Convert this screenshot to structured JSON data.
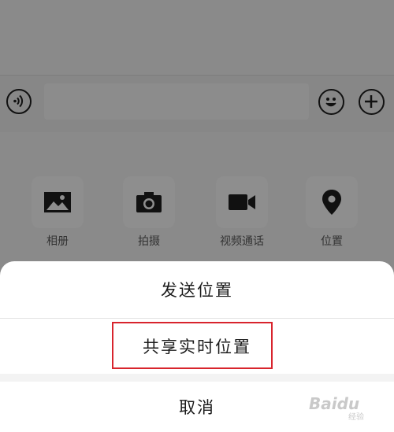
{
  "input_bar": {
    "voice_icon": "voice-wave-icon",
    "emoji_icon": "smiley-icon",
    "plus_icon": "plus-circle-icon"
  },
  "tools": [
    {
      "label": "相册",
      "icon": "photo-icon"
    },
    {
      "label": "拍摄",
      "icon": "camera-icon"
    },
    {
      "label": "视频通话",
      "icon": "video-call-icon"
    },
    {
      "label": "位置",
      "icon": "location-pin-icon"
    }
  ],
  "sheet": {
    "send_location": "发送位置",
    "share_live_location": "共享实时位置",
    "cancel": "取消"
  },
  "colors": {
    "overlay": "#898989",
    "sheet_bg": "#ffffff",
    "highlight": "#d8242d"
  },
  "watermark": {
    "text": "Baidu",
    "sub": "经验"
  }
}
